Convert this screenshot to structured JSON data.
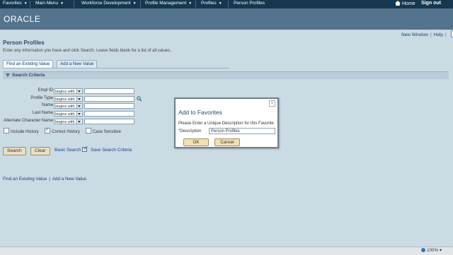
{
  "nav": {
    "items": [
      "Favorites",
      "Main Menu",
      "Workforce Development",
      "Profile Management",
      "Profiles",
      "Person Profiles"
    ],
    "home": "Home",
    "signout": "Sign out"
  },
  "brand": {
    "logo": "ORACLE"
  },
  "page_links": {
    "new_window": "New Window",
    "help": "Help"
  },
  "page": {
    "title": "Person Profiles",
    "instructions": "Enter any information you have and click Search. Leave fields blank for a list of all values."
  },
  "tabs": [
    "Find an Existing Value",
    "Add a New Value"
  ],
  "criteria_label": "Search Criteria",
  "fields": [
    {
      "label": "Empl ID",
      "operator": "begins with"
    },
    {
      "label": "Profile Type",
      "operator": "begins with"
    },
    {
      "label": "Name",
      "operator": "begins with"
    },
    {
      "label": "Last Name",
      "operator": "begins with"
    },
    {
      "label": "Alternate Character Name",
      "operator": "begins with"
    }
  ],
  "checkboxes": [
    {
      "label": "Include History",
      "checked": false
    },
    {
      "label": "Correct History",
      "checked": true
    },
    {
      "label": "Case Sensitive",
      "checked": false
    }
  ],
  "buttons": {
    "search": "Search",
    "clear": "Clear"
  },
  "links": {
    "basic_search": "Basic Search",
    "save_criteria": "Save Search Criteria"
  },
  "bottom_links": [
    "Find an Existing Value",
    "Add a New Value"
  ],
  "modal": {
    "title": "Add to Favorites",
    "prompt": "Please Enter a Unique Description for this Favorite",
    "field_label": "*Description",
    "field_value": "Person Profiles",
    "ok": "OK",
    "cancel": "Cancel",
    "close": "x"
  },
  "status": {
    "zoom": "100%"
  }
}
